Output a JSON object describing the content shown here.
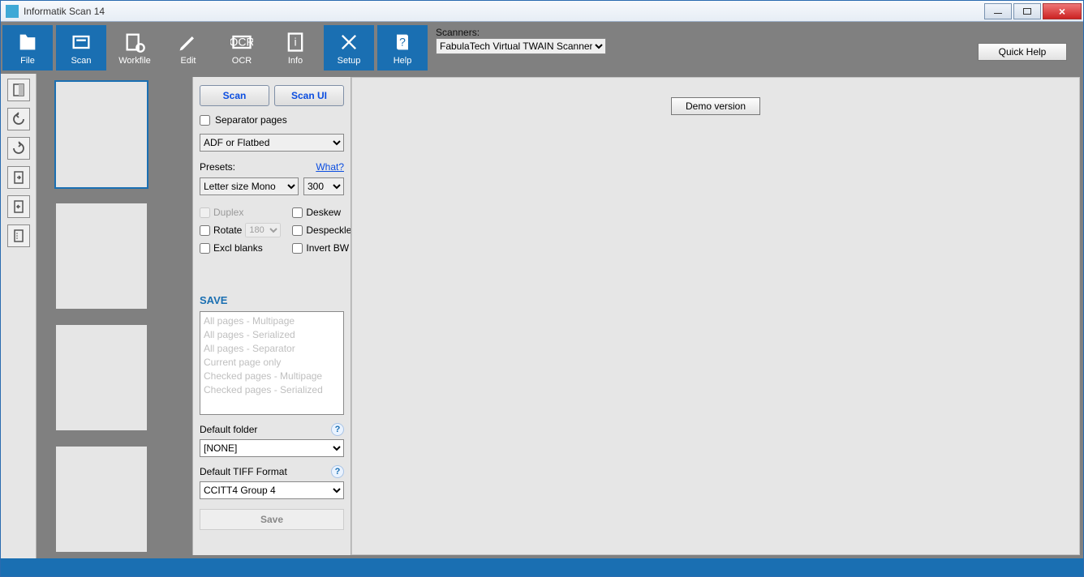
{
  "title": "Informatik Scan 14",
  "toolbar": {
    "file": "File",
    "scan": "Scan",
    "workfile": "Workfile",
    "edit": "Edit",
    "ocr": "OCR",
    "info": "Info",
    "setup": "Setup",
    "help": "Help"
  },
  "scanners": {
    "label": "Scanners:",
    "selected": "FabulaTech Virtual TWAIN Scanner"
  },
  "quickhelp": "Quick Help",
  "panel": {
    "scan": "Scan",
    "scanui": "Scan UI",
    "separator": "Separator pages",
    "source": "ADF or Flatbed",
    "presets_lbl": "Presets:",
    "what": "What?",
    "preset": "Letter size Mono",
    "dpi": "300",
    "duplex": "Duplex",
    "deskew": "Deskew",
    "rotate": "Rotate",
    "rotate_val": "180",
    "despeckle": "Despeckle",
    "excl": "Excl blanks",
    "invert": "Invert BW",
    "saveheader": "SAVE",
    "list": [
      "All pages - Multipage",
      "All pages - Serialized",
      "All pages - Separator",
      "Current page only",
      "Checked pages - Multipage",
      "Checked pages - Serialized"
    ],
    "default_folder_lbl": "Default folder",
    "default_folder": "[NONE]",
    "tiff_lbl": "Default TIFF Format",
    "tiff": "CCITT4 Group 4",
    "save": "Save"
  },
  "demo": "Demo version"
}
